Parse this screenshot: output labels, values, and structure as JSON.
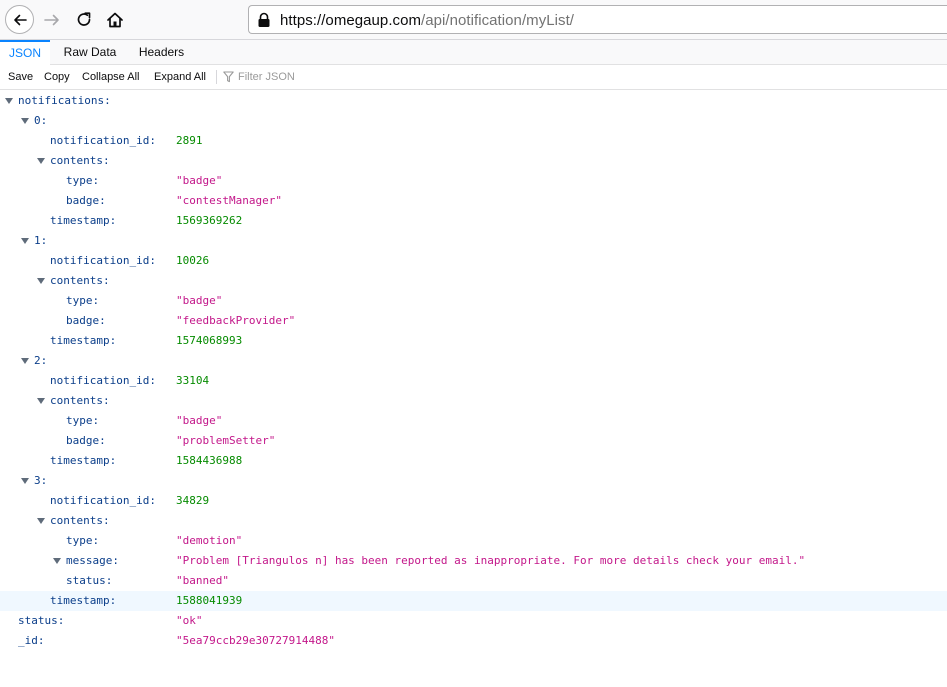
{
  "browser": {
    "url_host": "https://omegaup.com",
    "url_path": "/api/notification/myList/"
  },
  "viewer": {
    "tabs": [
      {
        "label": "JSON",
        "selected": true
      },
      {
        "label": "Raw Data",
        "selected": false
      },
      {
        "label": "Headers",
        "selected": false
      }
    ],
    "toolbar": {
      "save": "Save",
      "copy": "Copy",
      "collapse_all": "Collapse All",
      "expand_all": "Expand All",
      "filter_placeholder": "Filter JSON"
    }
  },
  "tree": {
    "root_key": "notifications:",
    "items": [
      {
        "index": "0:",
        "notification_id_key": "notification_id:",
        "notification_id": "2891",
        "contents_key": "contents:",
        "fields": [
          {
            "key": "type:",
            "value": "\"badge\""
          },
          {
            "key": "badge:",
            "value": "\"contestManager\""
          }
        ],
        "timestamp_key": "timestamp:",
        "timestamp": "1569369262"
      },
      {
        "index": "1:",
        "notification_id_key": "notification_id:",
        "notification_id": "10026",
        "contents_key": "contents:",
        "fields": [
          {
            "key": "type:",
            "value": "\"badge\""
          },
          {
            "key": "badge:",
            "value": "\"feedbackProvider\""
          }
        ],
        "timestamp_key": "timestamp:",
        "timestamp": "1574068993"
      },
      {
        "index": "2:",
        "notification_id_key": "notification_id:",
        "notification_id": "33104",
        "contents_key": "contents:",
        "fields": [
          {
            "key": "type:",
            "value": "\"badge\""
          },
          {
            "key": "badge:",
            "value": "\"problemSetter\""
          }
        ],
        "timestamp_key": "timestamp:",
        "timestamp": "1584436988"
      },
      {
        "index": "3:",
        "notification_id_key": "notification_id:",
        "notification_id": "34829",
        "contents_key": "contents:",
        "fields": [
          {
            "key": "type:",
            "value": "\"demotion\""
          },
          {
            "key": "message:",
            "value": "\"Problem [Triangulos n] has been reported as inappropriate. For more details check your email.\""
          },
          {
            "key": "status:",
            "value": "\"banned\""
          }
        ],
        "timestamp_key": "timestamp:",
        "timestamp": "1588041939"
      }
    ],
    "status_key": "status:",
    "status": "\"ok\"",
    "id_key": "_id:",
    "id": "\"5ea79ccb29e30727914488\""
  },
  "colors": {
    "key": "#0b3e8a",
    "string": "#c3178a",
    "number": "#058b00",
    "accent": "#0a84ff",
    "highlight": "#f0f8ff"
  },
  "icons": [
    "back-arrow-icon",
    "forward-arrow-icon",
    "reload-icon",
    "home-icon",
    "lock-icon",
    "filter-icon",
    "expand-triangle-icon"
  ]
}
